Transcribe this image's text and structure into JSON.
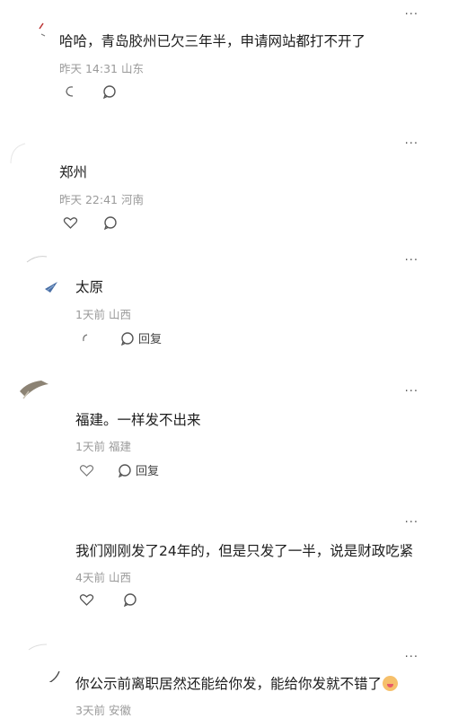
{
  "comments": [
    {
      "text": "哈哈，青岛胶州已欠三年半，申请网站都打不开了",
      "time": "昨天 14:31",
      "location": "山东",
      "reply_label": ""
    },
    {
      "text": "郑州",
      "time": "昨天 22:41",
      "location": "河南",
      "reply_label": ""
    },
    {
      "text": "太原",
      "time": "1天前",
      "location": "山西",
      "reply_label": "回复"
    },
    {
      "text": "福建。一样发不出来",
      "time": "1天前",
      "location": "福建",
      "reply_label": "回复"
    },
    {
      "text": "我们刚刚发了24年的，但是只发了一半，说是财政吃紧",
      "time": "4天前",
      "location": "山西",
      "reply_label": ""
    },
    {
      "text": "你公示前离职居然还能给你发，能给你发就不错了",
      "time": "3天前",
      "location": "安徽",
      "reply_label": ""
    }
  ],
  "more_glyph": "···",
  "icons": {
    "like": "heart-icon",
    "comment": "comment-icon",
    "more": "more-icon",
    "emoji": "emoji-icon"
  }
}
